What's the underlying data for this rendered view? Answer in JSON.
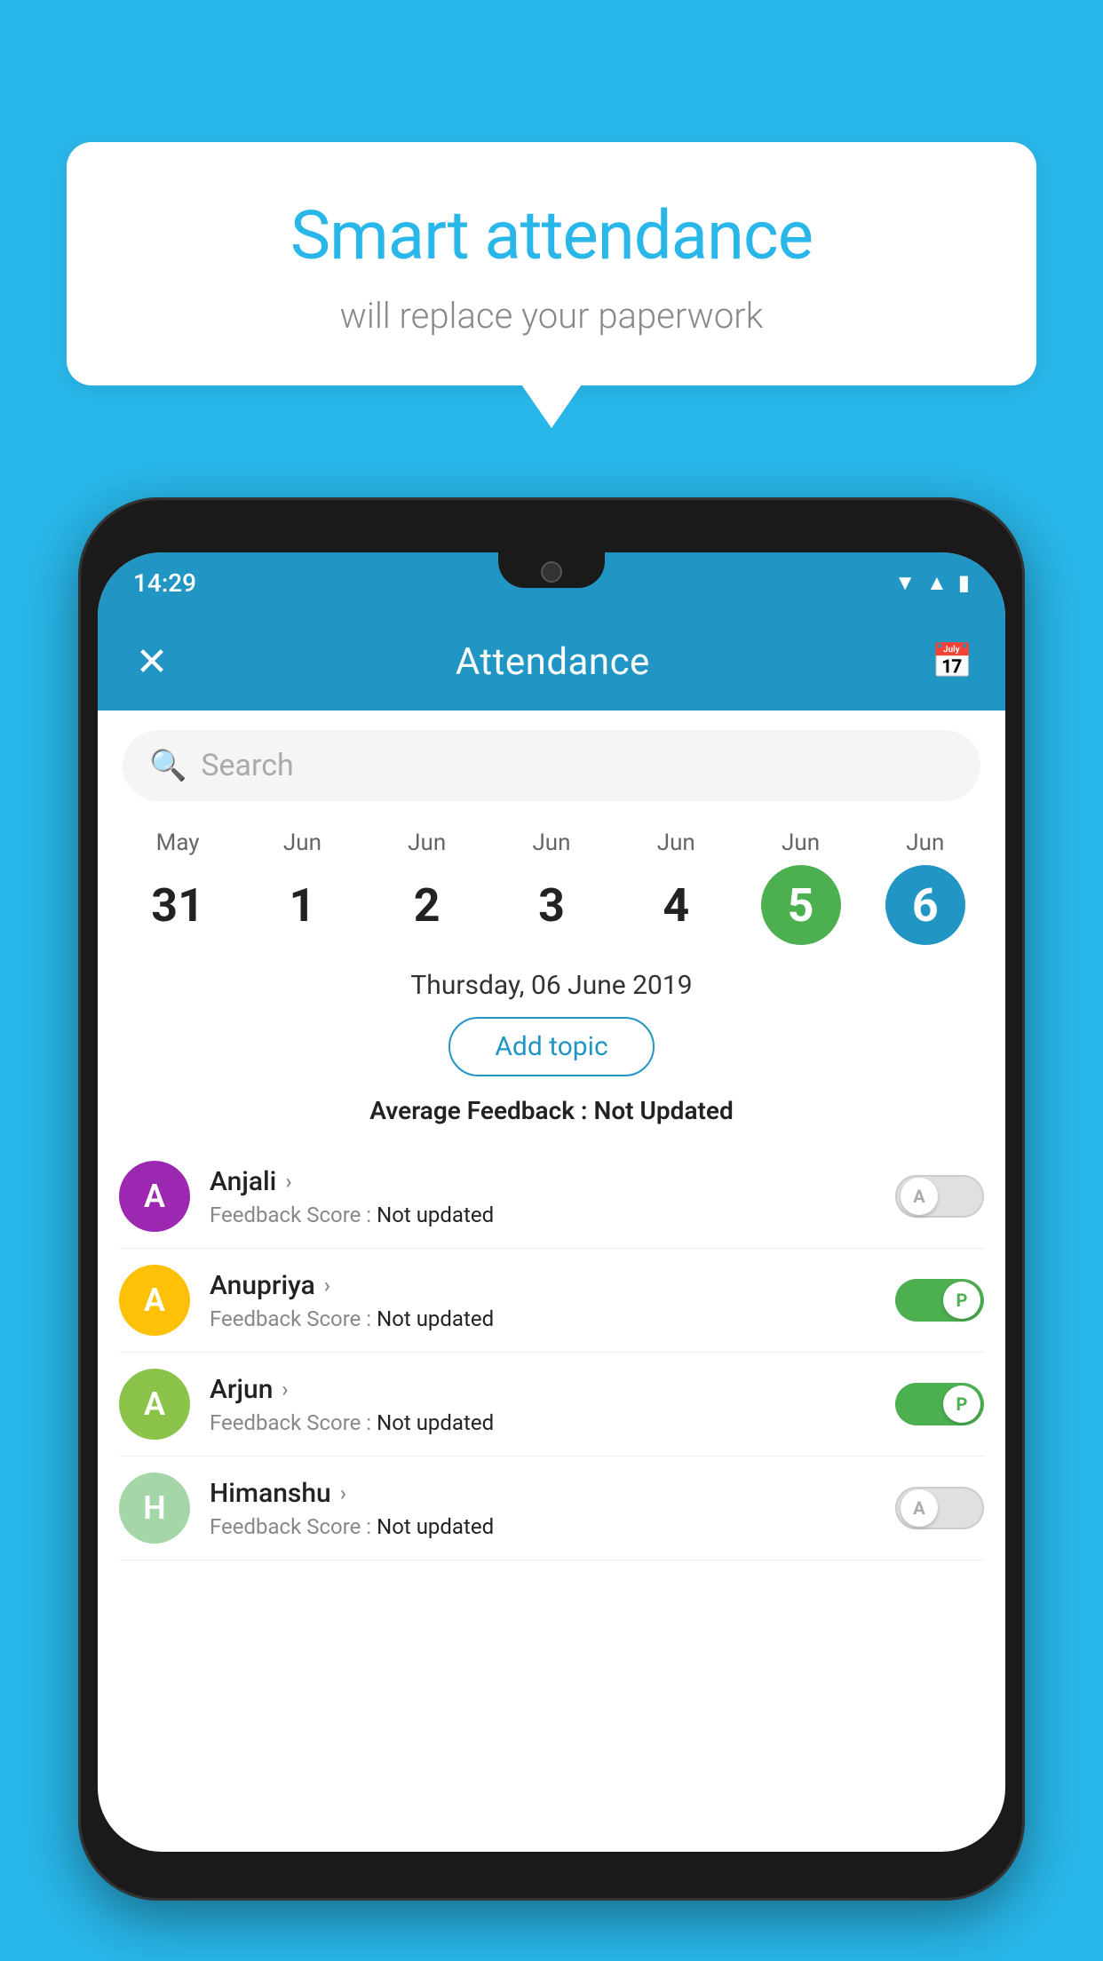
{
  "background_color": "#29b6e8",
  "speech_bubble": {
    "title": "Smart attendance",
    "subtitle": "will replace your paperwork"
  },
  "status_bar": {
    "time": "14:29",
    "wifi_icon": "▼",
    "signal_icon": "▲",
    "battery_icon": "▮"
  },
  "header": {
    "title": "Attendance",
    "close_icon": "✕",
    "calendar_icon": "📅"
  },
  "search": {
    "placeholder": "Search"
  },
  "calendar": {
    "days": [
      {
        "month": "May",
        "num": "31",
        "style": "normal"
      },
      {
        "month": "Jun",
        "num": "1",
        "style": "normal"
      },
      {
        "month": "Jun",
        "num": "2",
        "style": "normal"
      },
      {
        "month": "Jun",
        "num": "3",
        "style": "normal"
      },
      {
        "month": "Jun",
        "num": "4",
        "style": "normal"
      },
      {
        "month": "Jun",
        "num": "5",
        "style": "selected-green"
      },
      {
        "month": "Jun",
        "num": "6",
        "style": "selected-blue"
      }
    ]
  },
  "selected_date": "Thursday, 06 June 2019",
  "add_topic_label": "Add topic",
  "average_feedback_label": "Average Feedback :",
  "average_feedback_value": "Not Updated",
  "students": [
    {
      "name": "Anjali",
      "avatar_letter": "A",
      "avatar_color": "#9c27b0",
      "feedback_label": "Feedback Score :",
      "feedback_value": "Not updated",
      "toggle": "off",
      "toggle_letter": "A"
    },
    {
      "name": "Anupriya",
      "avatar_letter": "A",
      "avatar_color": "#ffc107",
      "feedback_label": "Feedback Score :",
      "feedback_value": "Not updated",
      "toggle": "on",
      "toggle_letter": "P"
    },
    {
      "name": "Arjun",
      "avatar_letter": "A",
      "avatar_color": "#8bc34a",
      "feedback_label": "Feedback Score :",
      "feedback_value": "Not updated",
      "toggle": "on",
      "toggle_letter": "P"
    },
    {
      "name": "Himanshu",
      "avatar_letter": "H",
      "avatar_color": "#a5d6a7",
      "feedback_label": "Feedback Score :",
      "feedback_value": "Not updated",
      "toggle": "off",
      "toggle_letter": "A"
    }
  ]
}
